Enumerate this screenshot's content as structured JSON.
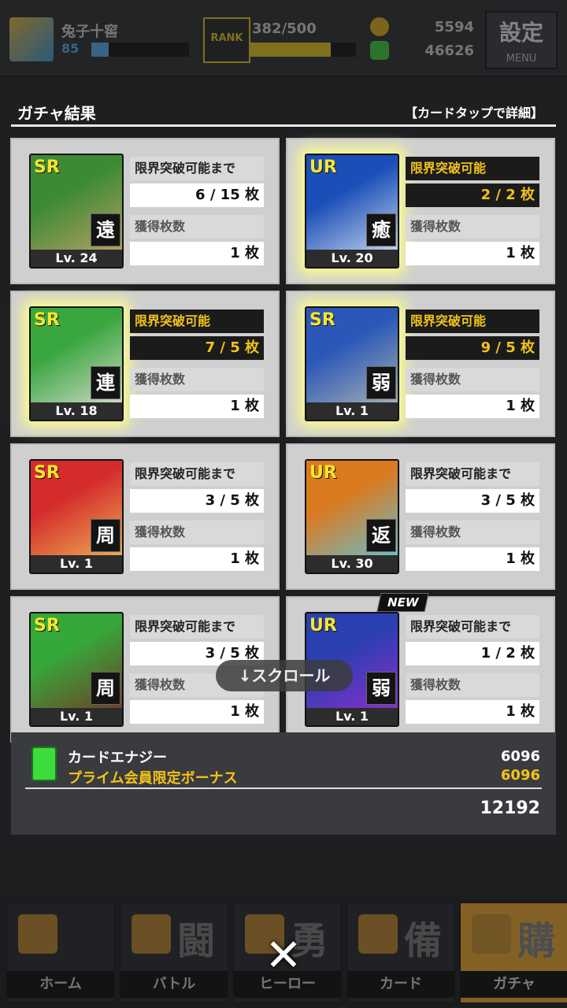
{
  "header": {
    "player_name": "兔子十窖",
    "player_level": "85",
    "level_progress": 0.18,
    "rank_label": "RANK",
    "rank_progress_text": "382/500",
    "rank_progress": 0.764,
    "coins": "5594",
    "energy": "46626",
    "settings_title": "設定",
    "settings_sub": "MENU"
  },
  "results": {
    "title": "ガチャ結果",
    "hint": "【カードタップで詳細】"
  },
  "cards": [
    {
      "rarity": "SR",
      "role": "遠",
      "level": "Lv. 24",
      "glow": false,
      "new": false,
      "label1": "限界突破可能まで",
      "value1": "6 / 15 枚",
      "break_ready": false,
      "owned_label": "獲得枚数",
      "owned": "1 枚",
      "art": [
        "#3d8a35",
        "#c9a36b"
      ]
    },
    {
      "rarity": "UR",
      "role": "癒",
      "level": "Lv. 20",
      "glow": true,
      "new": false,
      "label1": "限界突破可能",
      "value1": "2 / 2 枚",
      "break_ready": true,
      "owned_label": "獲得枚数",
      "owned": "1 枚",
      "art": [
        "#1a4fb8",
        "#dfe8f5"
      ]
    },
    {
      "rarity": "SR",
      "role": "連",
      "level": "Lv. 18",
      "glow": true,
      "new": false,
      "label1": "限界突破可能",
      "value1": "7 / 5 枚",
      "break_ready": true,
      "owned_label": "獲得枚数",
      "owned": "1 枚",
      "art": [
        "#3aa640",
        "#e9e2dc"
      ]
    },
    {
      "rarity": "SR",
      "role": "弱",
      "level": "Lv. 1",
      "glow": true,
      "new": false,
      "label1": "限界突破可能",
      "value1": "9 / 5 枚",
      "break_ready": true,
      "owned_label": "獲得枚数",
      "owned": "1 枚",
      "art": [
        "#2b57b8",
        "#b7bfb1"
      ]
    },
    {
      "rarity": "SR",
      "role": "周",
      "level": "Lv. 1",
      "glow": false,
      "new": false,
      "label1": "限界突破可能まで",
      "value1": "3 / 5 枚",
      "break_ready": false,
      "owned_label": "獲得枚数",
      "owned": "1 枚",
      "art": [
        "#d42c2c",
        "#f0c35a"
      ]
    },
    {
      "rarity": "UR",
      "role": "返",
      "level": "Lv. 30",
      "glow": false,
      "new": false,
      "label1": "限界突破可能まで",
      "value1": "3 / 5 枚",
      "break_ready": false,
      "owned_label": "獲得枚数",
      "owned": "1 枚",
      "art": [
        "#d97a20",
        "#57c9e6"
      ]
    },
    {
      "rarity": "SR",
      "role": "周",
      "level": "Lv. 1",
      "glow": false,
      "new": false,
      "label1": "限界突破可能まで",
      "value1": "3 / 5 枚",
      "break_ready": false,
      "owned_label": "獲得枚数",
      "owned": "1 枚",
      "art": [
        "#36a83a",
        "#7a2c27"
      ]
    },
    {
      "rarity": "UR",
      "role": "弱",
      "level": "Lv. 1",
      "glow": false,
      "new": true,
      "new_label": "NEW",
      "label1": "限界突破可能まで",
      "value1": "1 / 2 枚",
      "break_ready": false,
      "owned_label": "獲得枚数",
      "owned": "1 枚",
      "art": [
        "#2a3fb0",
        "#9b2bd0"
      ]
    }
  ],
  "scroll_hint": "↓スクロール",
  "energy_summary": {
    "energy_label": "カードエナジー",
    "energy_amount": "6096",
    "bonus_label": "プライム会員限定ボーナス",
    "bonus_amount": "6096",
    "total": "12192"
  },
  "nav": [
    {
      "name": "home",
      "label": "ホーム",
      "kanji": ""
    },
    {
      "name": "battle",
      "label": "バトル",
      "kanji": "闘"
    },
    {
      "name": "hero",
      "label": "ヒーロー",
      "kanji": "勇"
    },
    {
      "name": "card",
      "label": "カード",
      "kanji": "備"
    },
    {
      "name": "gacha",
      "label": "ガチャ",
      "kanji": "購"
    }
  ],
  "close_label": "✕",
  "colors": {
    "accent": "#f2c318",
    "panel": "#cfcfcf",
    "background": "#1e1f21"
  }
}
